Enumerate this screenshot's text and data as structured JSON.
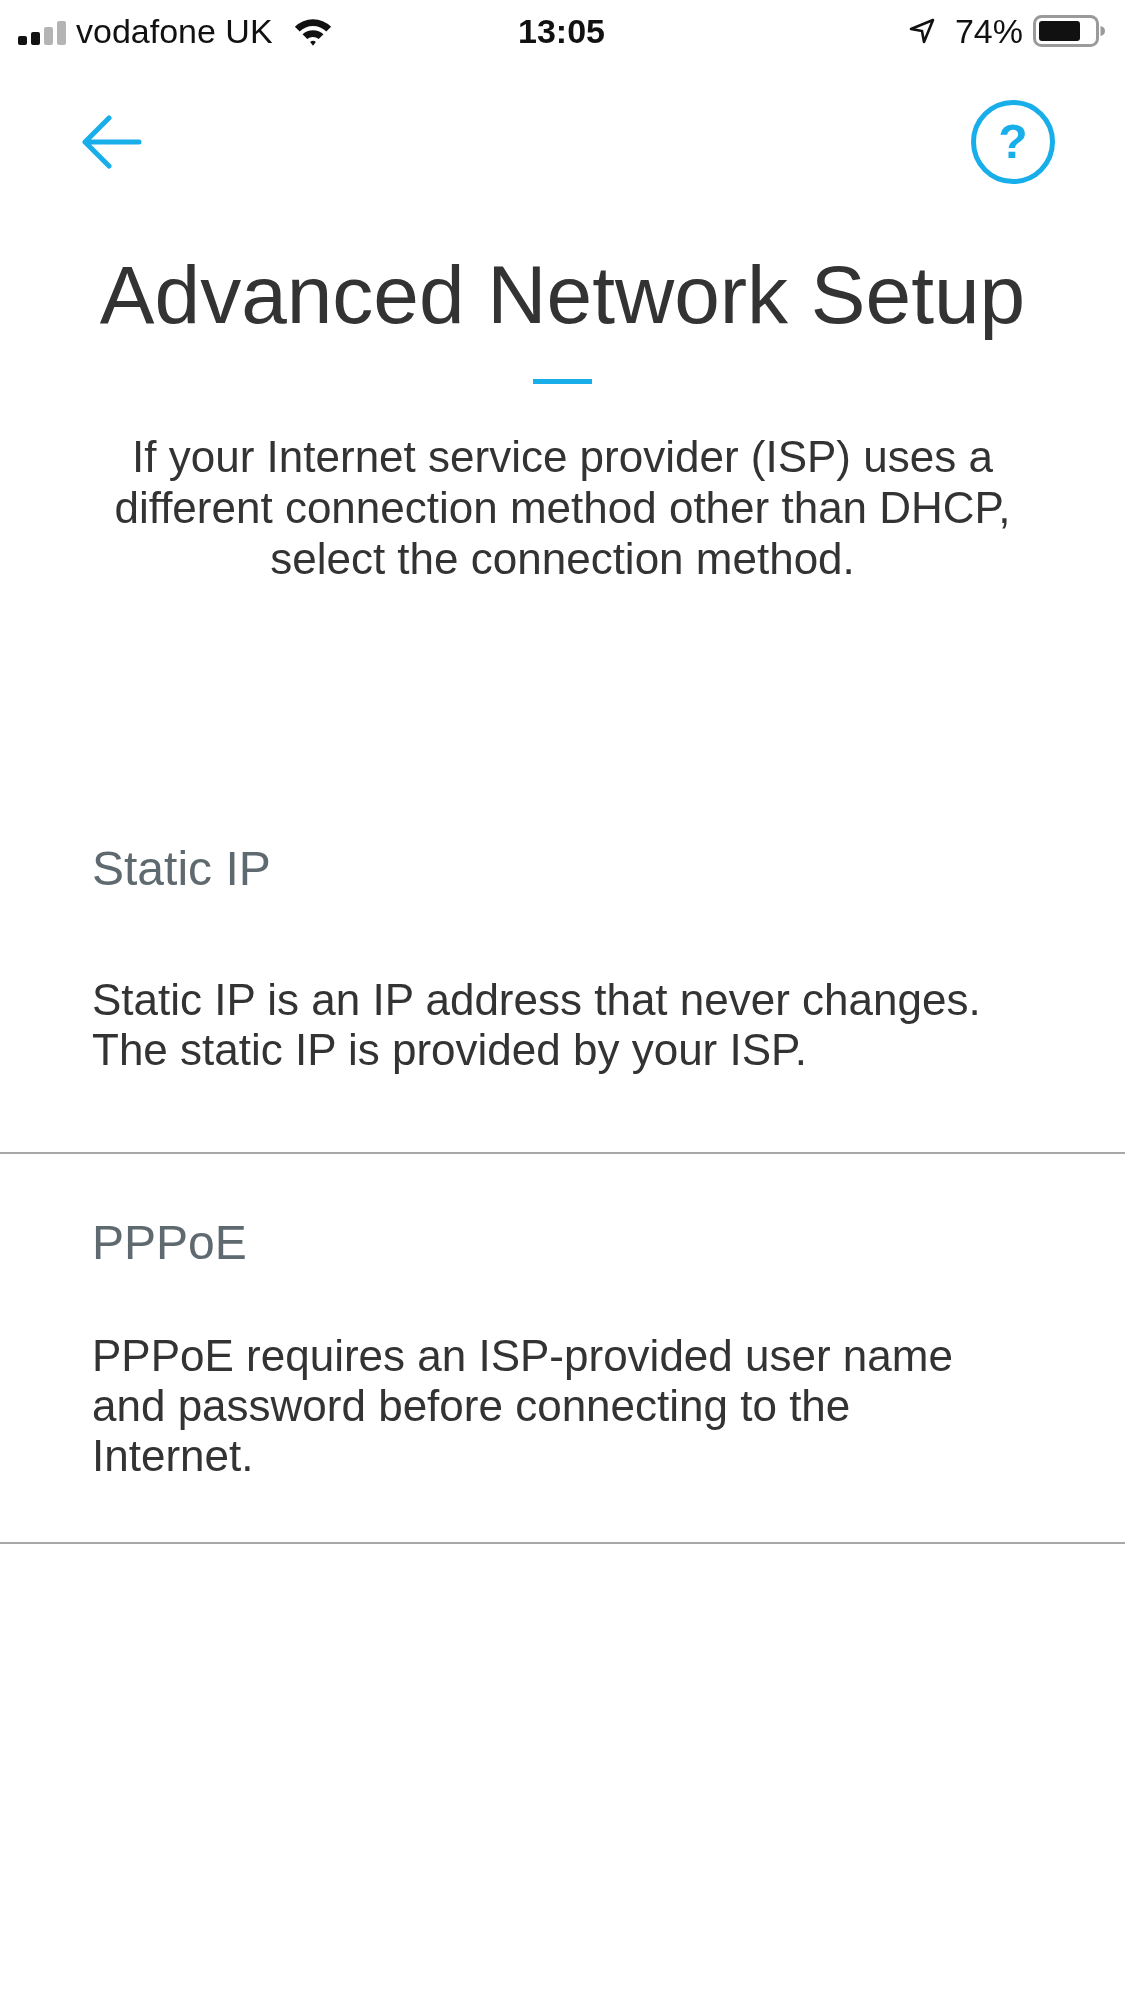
{
  "status_bar": {
    "carrier": "vodafone UK",
    "time": "13:05",
    "battery": "74%"
  },
  "help_button": {
    "label": "?"
  },
  "title": "Advanced Network Setup",
  "intro": "If your Internet service provider (ISP) uses a different connection method other than DHCP, select the connection method.",
  "options": [
    {
      "title": "Static IP",
      "description": "Static IP is an IP address that never changes. The static IP is provided by your ISP."
    },
    {
      "title": "PPPoE",
      "description": "PPPoE requires an ISP-provided user name and password before connecting to the Internet."
    }
  ]
}
